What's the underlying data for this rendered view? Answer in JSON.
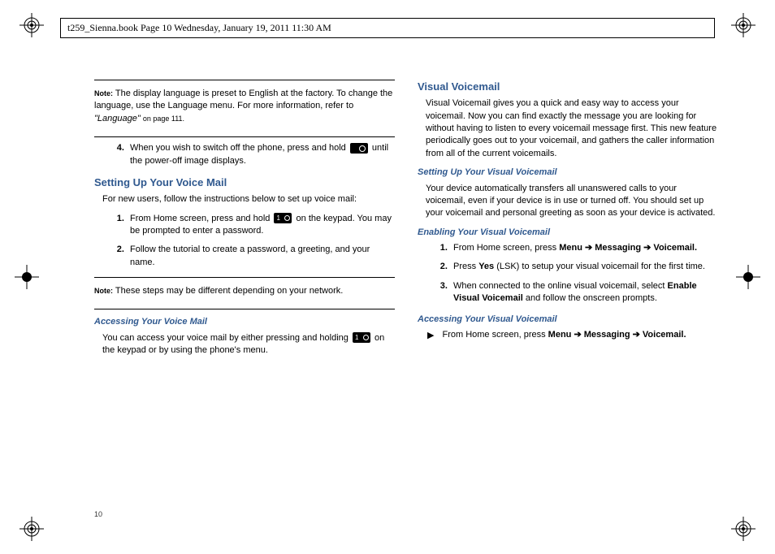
{
  "header": {
    "running": "t259_Sienna.book  Page 10  Wednesday, January 19, 2011  11:30 AM"
  },
  "page_number": "10",
  "left": {
    "note1": {
      "label": "Note:",
      "body_a": "The display language is preset to English at the factory. To change the language, use the Language menu. For more information, refer to ",
      "body_ref": "\"Language\"",
      "body_b": " on page 111."
    },
    "step4": {
      "num": "4.",
      "text_a": "When you wish to switch off the phone, press and hold ",
      "text_b": " until the power-off image displays."
    },
    "h_voice_mail": "Setting Up Your Voice Mail",
    "vm_intro": "For new users, follow the instructions below to set up voice mail:",
    "vm_steps": {
      "s1_a": "From Home screen, press and hold ",
      "s1_b": " on the keypad. You may be prompted to enter a password.",
      "s2": "Follow the tutorial to create a password, a greeting, and your name."
    },
    "note2": {
      "label": "Note:",
      "body": "These steps may be different depending on your network."
    },
    "h_access_vm": "Accessing Your Voice Mail",
    "access_vm": {
      "a": "You can access your voice mail by either pressing and holding ",
      "b": " on the keypad or by using the phone's menu."
    }
  },
  "right": {
    "h_visual": "Visual Voicemail",
    "visual_intro": "Visual Voicemail gives you a quick and easy way to access your voicemail. Now you can find exactly the message you are looking for without having to listen to every voicemail message first. This new feature periodically goes out to your voicemail, and gathers the caller information from all of the current voicemails.",
    "h_setup_vv": "Setting Up Your Visual Voicemail",
    "setup_vv": "Your device automatically transfers all unanswered calls to your voicemail, even if your device is in use or turned off. You should set up your voicemail and personal greeting as soon as your device is activated.",
    "h_enable_vv": "Enabling Your Visual Voicemail",
    "enable_steps": {
      "s1_a": "From Home screen, press ",
      "s1_b": "Menu ➔ Messaging ➔ Voicemail.",
      "s2_a": "Press ",
      "s2_b": "Yes",
      "s2_c": " (LSK) to setup your visual voicemail for the first time.",
      "s3_a": "When connected to the online visual voicemail, select ",
      "s3_b": "Enable Visual Voicemail",
      "s3_c": " and follow the onscreen prompts."
    },
    "h_access_vv": "Accessing Your Visual Voicemail",
    "access_vv": {
      "a": "From Home screen, press ",
      "b": "Menu ➔ Messaging ➔ Voicemail."
    }
  }
}
